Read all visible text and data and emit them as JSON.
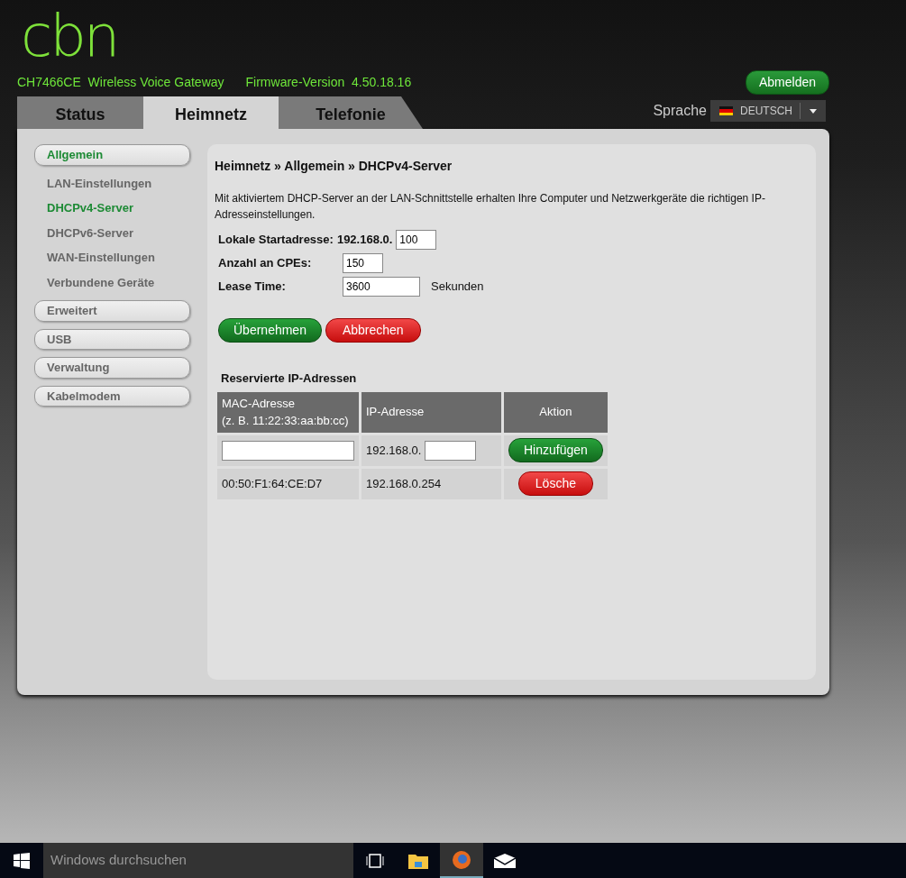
{
  "header": {
    "logo": "cbn",
    "model": "CH7466CE  Wireless Voice Gateway",
    "firmware": "Firmware-Version  4.50.18.16",
    "logout": "Abmelden",
    "language_label": "Sprache",
    "language": "DEUTSCH"
  },
  "tabs": [
    {
      "label": "Status",
      "selected": false
    },
    {
      "label": "Heimnetz",
      "selected": true
    },
    {
      "label": "Telefonie",
      "selected": false
    }
  ],
  "sidebar": {
    "items": [
      {
        "label": "Allgemein",
        "selected": true,
        "children": [
          {
            "label": "LAN-Einstellungen",
            "selected": false
          },
          {
            "label": "DHCPv4-Server",
            "selected": true
          },
          {
            "label": "DHCPv6-Server",
            "selected": false
          },
          {
            "label": "WAN-Einstellungen",
            "selected": false
          },
          {
            "label": "Verbundene Geräte",
            "selected": false
          }
        ]
      },
      {
        "label": "Erweitert",
        "selected": false
      },
      {
        "label": "USB",
        "selected": false
      },
      {
        "label": "Verwaltung",
        "selected": false
      },
      {
        "label": "Kabelmodem",
        "selected": false
      }
    ]
  },
  "content": {
    "breadcrumb": "Heimnetz » Allgemein » DHCPv4-Server",
    "description": "Mit aktiviertem DHCP-Server an der LAN-Schnittstelle erhalten Ihre Computer und Netzwerkgeräte die richtigen IP-Adresseinstellungen.",
    "fields": [
      {
        "label": "Lokale Startadresse:",
        "prefix": "192.168.0.",
        "value": "100"
      },
      {
        "label": "Anzahl an CPEs:",
        "value": "150"
      },
      {
        "label": "Lease Time:",
        "value": "3600",
        "unit": "Sekunden"
      }
    ],
    "buttons": [
      {
        "label": "Übernehmen",
        "kind": "primary"
      },
      {
        "label": "Abbrechen",
        "kind": "danger"
      }
    ],
    "reserved": {
      "title": "Reservierte IP-Adressen",
      "columns": [
        "MAC-Adresse\n(z. B. 11:22:33:aa:bb:cc)",
        "IP-Adresse",
        "Aktion"
      ],
      "new_row": {
        "ip_prefix": "192.168.0.",
        "button": "Hinzufügen"
      },
      "rows": [
        {
          "mac": "00:50:F1:64:CE:D7",
          "ip": "192.168.0.254",
          "button": "Lösche"
        }
      ]
    }
  },
  "taskbar": {
    "search_placeholder": "Windows durchsuchen"
  }
}
